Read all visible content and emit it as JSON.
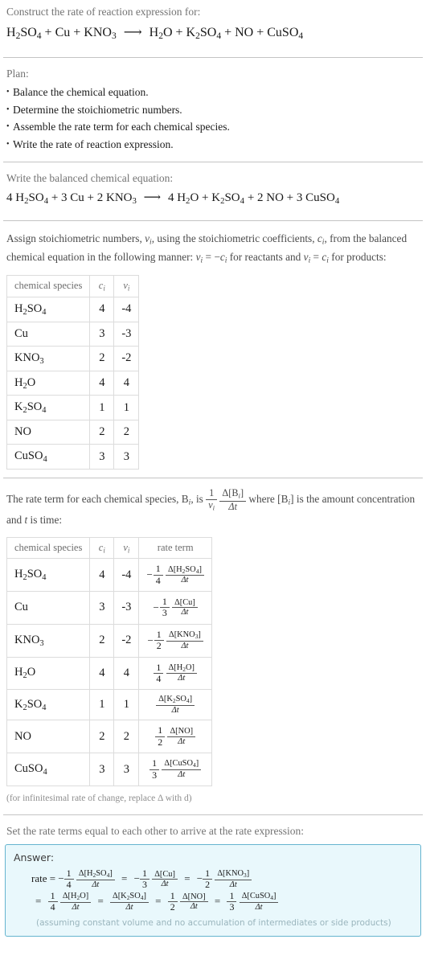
{
  "header": {
    "prompt": "Construct the rate of reaction expression for:",
    "equation_html": "H<sub>2</sub>SO<sub>4</sub> + Cu + KNO<sub>3</sub> <span class=\"arrow\">&#10230;</span> H<sub>2</sub>O + K<sub>2</sub>SO<sub>4</sub> + NO + CuSO<sub>4</sub>"
  },
  "plan": {
    "label": "Plan:",
    "steps": [
      "Balance the chemical equation.",
      "Determine the stoichiometric numbers.",
      "Assemble the rate term for each chemical species.",
      "Write the rate of reaction expression."
    ]
  },
  "balanced": {
    "label": "Write the balanced chemical equation:",
    "equation_html": "4 H<sub>2</sub>SO<sub>4</sub> + 3 Cu + 2 KNO<sub>3</sub> <span class=\"arrow\">&#10230;</span> 4 H<sub>2</sub>O + K<sub>2</sub>SO<sub>4</sub> + 2 NO + 3 CuSO<sub>4</sub>"
  },
  "stoich_intro": {
    "text_html": "Assign stoichiometric numbers, <span class=\"it\">v<sub>i</sub></span>, using the stoichiometric coefficients, <span class=\"it\">c<sub>i</sub></span>, from the balanced chemical equation in the following manner: <span class=\"it\">v<sub>i</sub></span> = &minus;<span class=\"it\">c<sub>i</sub></span> for reactants and <span class=\"it\">v<sub>i</sub></span> = <span class=\"it\">c<sub>i</sub></span> for products:"
  },
  "table1": {
    "headers": [
      "chemical species",
      "c_i",
      "v_i"
    ],
    "header_html": [
      "chemical species",
      "<span class=\"it\">c<sub>i</sub></span>",
      "<span class=\"it\">v<sub>i</sub></span>"
    ],
    "rows": [
      {
        "species_html": "H<sub>2</sub>SO<sub>4</sub>",
        "species": "H2SO4",
        "c": "4",
        "v": "-4"
      },
      {
        "species_html": "Cu",
        "species": "Cu",
        "c": "3",
        "v": "-3"
      },
      {
        "species_html": "KNO<sub>3</sub>",
        "species": "KNO3",
        "c": "2",
        "v": "-2"
      },
      {
        "species_html": "H<sub>2</sub>O",
        "species": "H2O",
        "c": "4",
        "v": "4"
      },
      {
        "species_html": "K<sub>2</sub>SO<sub>4</sub>",
        "species": "K2SO4",
        "c": "1",
        "v": "1"
      },
      {
        "species_html": "NO",
        "species": "NO",
        "c": "2",
        "v": "2"
      },
      {
        "species_html": "CuSO<sub>4</sub>",
        "species": "CuSO4",
        "c": "3",
        "v": "3"
      }
    ]
  },
  "rate_intro": {
    "text_html": "The rate term for each chemical species, B<span class=\"it\"><sub>i</sub></span>, is <span class=\"frac\"><span class=\"n\">1</span><span class=\"d\"><span class=\"it\">v<sub>i</sub></span></span></span> <span class=\"frac\"><span class=\"n\">&Delta;[B<span class=\"it\"><sub>i</sub></span>]</span><span class=\"d\"><span class=\"it\">&Delta;t</span></span></span> where [B<span class=\"it\"><sub>i</sub></span>] is the amount concentration and <span class=\"it\">t</span> is time:"
  },
  "table2": {
    "headers": [
      "chemical species",
      "c_i",
      "v_i",
      "rate term"
    ],
    "header_html": [
      "chemical species",
      "<span class=\"it\">c<sub>i</sub></span>",
      "<span class=\"it\">v<sub>i</sub></span>",
      "rate term"
    ],
    "rows": [
      {
        "species_html": "H<sub>2</sub>SO<sub>4</sub>",
        "species": "H2SO4",
        "c": "4",
        "v": "-4",
        "rate_html": "<span class=\"rate-expr\"><span class=\"lead\">&minus;</span><span class=\"frac\"><span class=\"n\">1</span><span class=\"d\">4</span></span> <span class=\"frac small\"><span class=\"n\">&Delta;[H<sub>2</sub>SO<sub>4</sub>]</span><span class=\"d\"><span class=\"it\">&Delta;t</span></span></span></span>"
      },
      {
        "species_html": "Cu",
        "species": "Cu",
        "c": "3",
        "v": "-3",
        "rate_html": "<span class=\"rate-expr\"><span class=\"lead\">&minus;</span><span class=\"frac\"><span class=\"n\">1</span><span class=\"d\">3</span></span> <span class=\"frac small\"><span class=\"n\">&Delta;[Cu]</span><span class=\"d\"><span class=\"it\">&Delta;t</span></span></span></span>"
      },
      {
        "species_html": "KNO<sub>3</sub>",
        "species": "KNO3",
        "c": "2",
        "v": "-2",
        "rate_html": "<span class=\"rate-expr\"><span class=\"lead\">&minus;</span><span class=\"frac\"><span class=\"n\">1</span><span class=\"d\">2</span></span> <span class=\"frac small\"><span class=\"n\">&Delta;[KNO<sub>3</sub>]</span><span class=\"d\"><span class=\"it\">&Delta;t</span></span></span></span>"
      },
      {
        "species_html": "H<sub>2</sub>O",
        "species": "H2O",
        "c": "4",
        "v": "4",
        "rate_html": "<span class=\"rate-expr\"><span class=\"frac\"><span class=\"n\">1</span><span class=\"d\">4</span></span> <span class=\"frac small\"><span class=\"n\">&Delta;[H<sub>2</sub>O]</span><span class=\"d\"><span class=\"it\">&Delta;t</span></span></span></span>"
      },
      {
        "species_html": "K<sub>2</sub>SO<sub>4</sub>",
        "species": "K2SO4",
        "c": "1",
        "v": "1",
        "rate_html": "<span class=\"rate-expr\"><span class=\"frac small\"><span class=\"n\">&Delta;[K<sub>2</sub>SO<sub>4</sub>]</span><span class=\"d\"><span class=\"it\">&Delta;t</span></span></span></span>"
      },
      {
        "species_html": "NO",
        "species": "NO",
        "c": "2",
        "v": "2",
        "rate_html": "<span class=\"rate-expr\"><span class=\"frac\"><span class=\"n\">1</span><span class=\"d\">2</span></span> <span class=\"frac small\"><span class=\"n\">&Delta;[NO]</span><span class=\"d\"><span class=\"it\">&Delta;t</span></span></span></span>"
      },
      {
        "species_html": "CuSO<sub>4</sub>",
        "species": "CuSO4",
        "c": "3",
        "v": "3",
        "rate_html": "<span class=\"rate-expr\"><span class=\"frac\"><span class=\"n\">1</span><span class=\"d\">3</span></span> <span class=\"frac small\"><span class=\"n\">&Delta;[CuSO<sub>4</sub>]</span><span class=\"d\"><span class=\"it\">&Delta;t</span></span></span></span>"
      }
    ],
    "footnote": "(for infinitesimal rate of change, replace Δ with d)"
  },
  "final": {
    "label": "Set the rate terms equal to each other to arrive at the rate expression:",
    "answer_label": "Answer:",
    "line1_html": "rate = <span class=\"lead\">&minus;</span><span class=\"frac\"><span class=\"n\">1</span><span class=\"d\">4</span></span> <span class=\"frac small\"><span class=\"n\">&Delta;[H<sub>2</sub>SO<sub>4</sub>]</span><span class=\"d\"><span class=\"it\">&Delta;t</span></span></span> <span class=\"eqsign\">=</span> <span class=\"lead\">&minus;</span><span class=\"frac\"><span class=\"n\">1</span><span class=\"d\">3</span></span> <span class=\"frac small\"><span class=\"n\">&Delta;[Cu]</span><span class=\"d\"><span class=\"it\">&Delta;t</span></span></span> <span class=\"eqsign\">=</span> <span class=\"lead\">&minus;</span><span class=\"frac\"><span class=\"n\">1</span><span class=\"d\">2</span></span> <span class=\"frac small\"><span class=\"n\">&Delta;[KNO<sub>3</sub>]</span><span class=\"d\"><span class=\"it\">&Delta;t</span></span></span>",
    "line2_html": "<span class=\"eqsign\">=</span> <span class=\"frac\"><span class=\"n\">1</span><span class=\"d\">4</span></span> <span class=\"frac small\"><span class=\"n\">&Delta;[H<sub>2</sub>O]</span><span class=\"d\"><span class=\"it\">&Delta;t</span></span></span> <span class=\"eqsign\">=</span> <span class=\"frac small\"><span class=\"n\">&Delta;[K<sub>2</sub>SO<sub>4</sub>]</span><span class=\"d\"><span class=\"it\">&Delta;t</span></span></span> <span class=\"eqsign\">=</span> <span class=\"frac\"><span class=\"n\">1</span><span class=\"d\">2</span></span> <span class=\"frac small\"><span class=\"n\">&Delta;[NO]</span><span class=\"d\"><span class=\"it\">&Delta;t</span></span></span> <span class=\"eqsign\">=</span> <span class=\"frac\"><span class=\"n\">1</span><span class=\"d\">3</span></span> <span class=\"frac small\"><span class=\"n\">&Delta;[CuSO<sub>4</sub>]</span><span class=\"d\"><span class=\"it\">&Delta;t</span></span></span>",
    "note": "(assuming constant volume and no accumulation of intermediates or side products)"
  },
  "colors": {
    "answer_border": "#65b4cf",
    "answer_background": "#e9f8fc",
    "table_border": "#dcdcdc",
    "separator": "#c4c4c4",
    "label_text": "#737373",
    "body_text": "#1a1a1a"
  }
}
